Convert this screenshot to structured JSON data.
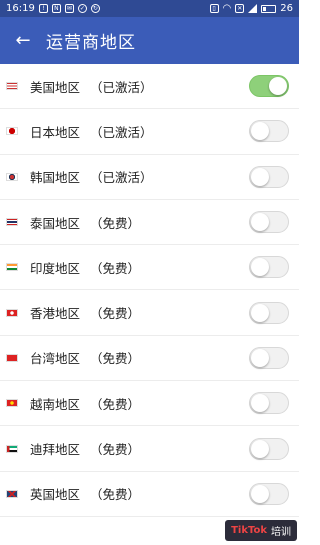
{
  "status_bar": {
    "time": "16:19",
    "battery": "26",
    "icons": [
      "alert-icon",
      "nfc-icon",
      "mail-icon",
      "check-icon",
      "sync-icon",
      "vibrate-icon",
      "wifi-icon",
      "no-sim-icon",
      "signal-icon",
      "battery-icon"
    ]
  },
  "app_bar": {
    "back_icon": "arrow-left-icon",
    "title": "运营商地区"
  },
  "regions": [
    {
      "name": "美国地区",
      "status": "（已激活）",
      "flag": "us",
      "enabled": true
    },
    {
      "name": "日本地区",
      "status": "（已激活）",
      "flag": "jp",
      "enabled": false
    },
    {
      "name": "韩国地区",
      "status": "（已激活）",
      "flag": "kr",
      "enabled": false
    },
    {
      "name": "泰国地区",
      "status": "（免费）",
      "flag": "th",
      "enabled": false
    },
    {
      "name": "印度地区",
      "status": "（免费）",
      "flag": "in",
      "enabled": false
    },
    {
      "name": "香港地区",
      "status": "（免费）",
      "flag": "hk",
      "enabled": false
    },
    {
      "name": "台湾地区",
      "status": "（免费）",
      "flag": "cn",
      "enabled": false
    },
    {
      "name": "越南地区",
      "status": "（免费）",
      "flag": "vn",
      "enabled": false
    },
    {
      "name": "迪拜地区",
      "status": "（免费）",
      "flag": "ae",
      "enabled": false
    },
    {
      "name": "英国地区",
      "status": "（免费）",
      "flag": "gb",
      "enabled": false
    }
  ],
  "watermark": {
    "logo": "TikTok",
    "text": "培训"
  },
  "colors": {
    "status_bar": "#2f4a94",
    "app_bar": "#3b5cb8",
    "switch_on": "#8ed07a"
  }
}
